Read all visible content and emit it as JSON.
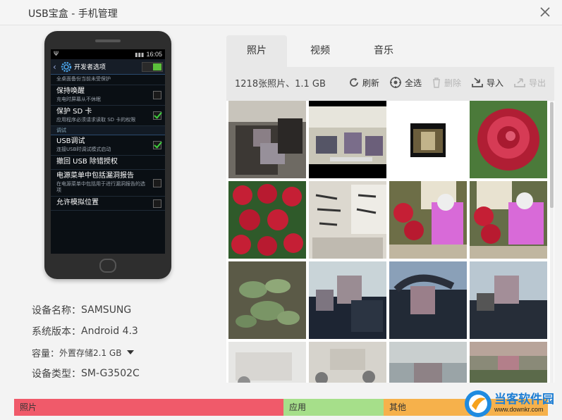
{
  "window": {
    "title": "USB宝盒 - 手机管理"
  },
  "phone": {
    "status_time": "16:05",
    "status_left": "Ψ",
    "action_title": "开发者选项",
    "items": [
      {
        "title": "",
        "desc": "全桌面备份当前未受保护",
        "checkbox": false,
        "checked": false
      },
      {
        "title": "保持唤醒",
        "desc": "充电时屏幕从不休眠",
        "checkbox": true,
        "checked": false
      },
      {
        "title": "保护 SD 卡",
        "desc": "应用程序必须请求读取 SD 卡的权限",
        "checkbox": true,
        "checked": true
      },
      {
        "section": "调试"
      },
      {
        "title": "USB调试",
        "desc": "连接USB时调试模式启动",
        "checkbox": true,
        "checked": true
      },
      {
        "title": "撤回 USB 除错授权",
        "desc": "",
        "checkbox": false,
        "checked": false
      },
      {
        "title": "电源菜单中包括漏洞报告",
        "desc": "在电源菜单中包括用于进行漏洞报告的选项",
        "checkbox": true,
        "checked": false
      },
      {
        "title": "允许模拟位置",
        "desc": "",
        "checkbox": true,
        "checked": false
      }
    ]
  },
  "device": {
    "name_label": "设备名称：",
    "name_value": "SAMSUNG",
    "version_label": "系统版本：",
    "version_value": "Android 4.3",
    "storage_label": "容量：",
    "storage_value": "外置存储2.1 GB",
    "type_label": "设备类型：",
    "type_value": "SM-G3502C"
  },
  "tabs": [
    {
      "label": "照片",
      "active": true
    },
    {
      "label": "视频",
      "active": false
    },
    {
      "label": "音乐",
      "active": false
    }
  ],
  "toolbar": {
    "summary": "1218张照片、1.1 GB",
    "refresh": "刷新",
    "select_all": "全选",
    "delete": "删除",
    "import": "导入",
    "export": "导出"
  },
  "storage_bar": {
    "photos": "照片",
    "apps": "应用",
    "other": "其他",
    "colors": {
      "photos": "#f05a6a",
      "apps": "#a6df8a",
      "other": "#f6b14b"
    }
  },
  "watermark": {
    "name": "当客软件园",
    "url": "www.downkr.com"
  }
}
